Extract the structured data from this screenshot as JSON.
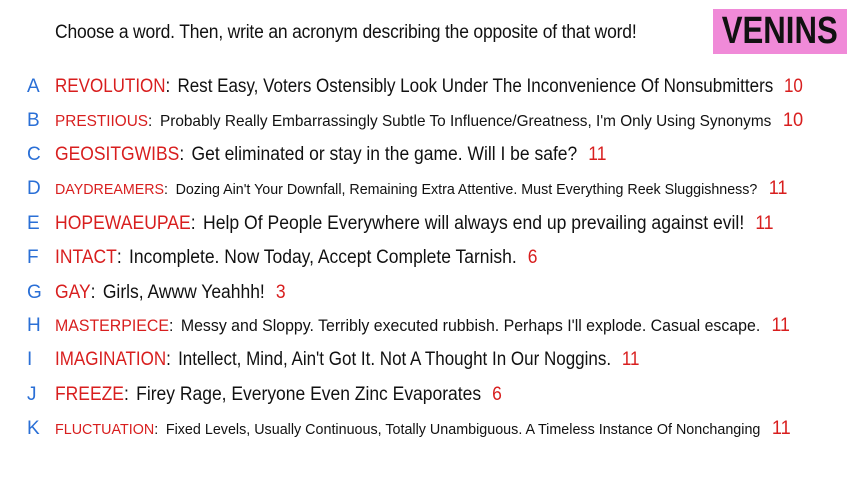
{
  "prompt": "Choose a word. Then, write an acronym describing the opposite of that word!",
  "badge": "VENINS",
  "colors": {
    "letter": "#2a6fd6",
    "word": "#d81e1e",
    "score": "#d81e1e",
    "badge_bg": "#f08ad8"
  },
  "rows": [
    {
      "letter": "A",
      "word": "REVOLUTION",
      "definition": "Rest Easy, Voters Ostensibly Look Under The Inconvenience Of Nonsubmitters",
      "score": "10"
    },
    {
      "letter": "B",
      "word": "PRESTIIOUS",
      "definition": "Probably Really Embarrassingly Subtle To Influence/Greatness, I'm Only Using Synonyms",
      "score": "10"
    },
    {
      "letter": "C",
      "word": "GEOSITGWIBS",
      "definition": "Get eliminated or stay in the game. Will I be safe?",
      "score": "11"
    },
    {
      "letter": "D",
      "word": "DAYDREAMERS",
      "definition": "Dozing Ain't Your Downfall, Remaining Extra Attentive. Must Everything Reek Sluggishness?",
      "score": "11"
    },
    {
      "letter": "E",
      "word": "HOPEWAEUPAE",
      "definition": "Help Of People Everywhere will always end up prevailing against evil!",
      "score": "11"
    },
    {
      "letter": "F",
      "word": "INTACT",
      "definition": "Incomplete. Now Today, Accept Complete Tarnish.",
      "score": "6"
    },
    {
      "letter": "G",
      "word": "GAY",
      "definition": "Girls, Awww Yeahhh!",
      "score": "3"
    },
    {
      "letter": "H",
      "word": "MASTERPIECE",
      "definition": "Messy and Sloppy. Terribly executed rubbish. Perhaps I'll explode. Casual escape.",
      "score": "11"
    },
    {
      "letter": "I",
      "word": "IMAGINATION",
      "definition": "Intellect, Mind, Ain't Got It. Not A Thought In Our Noggins.",
      "score": "11"
    },
    {
      "letter": "J",
      "word": "FREEZE",
      "definition": "Firey Rage, Everyone Even Zinc Evaporates",
      "score": "6"
    },
    {
      "letter": "K",
      "word": "FLUCTUATION",
      "definition": "Fixed Levels, Usually Continuous, Totally Unambiguous. A Timeless Instance Of Nonchanging",
      "score": "11"
    }
  ]
}
